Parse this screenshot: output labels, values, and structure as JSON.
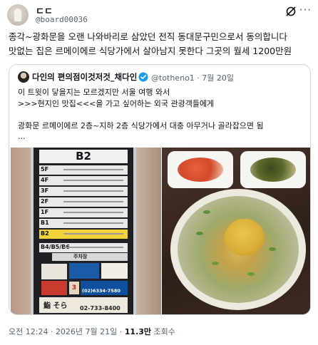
{
  "author": {
    "display_name": "ㄷㄷ",
    "handle": "@board00036"
  },
  "tweet": {
    "lines": [
      "종각~광화문을 오랜 나와바리로 삼았던 전직 동대문구민으로서 동의합니다",
      "맛없는 집은 르메이에르 식당가에서 살아남지 못한다 그곳의 월세 1200만원"
    ]
  },
  "quote": {
    "display_name": "다인의 편의점이것저것_채다인",
    "handle": "@totheno1",
    "date": "7월 20일",
    "separator": "·",
    "lines": [
      "이 트윗이 닿을지는 모르겠지만 서울 여행 와서",
      ">>>현지인 맛집<<<을 가고 싶어하는 외국 관광객들에게",
      "",
      "광화문 르메이에르 2층~지하 2층 식당가에서 대충 아무거나 골라잡으면 됨",
      "..."
    ]
  },
  "directory_sign": {
    "floor": "B2",
    "rows": [
      "5F",
      "4F",
      "3F",
      "2F",
      "1F",
      "B1",
      "B2",
      "B4/B5/B6"
    ],
    "parking_label": "주차장",
    "ad_phone": "02-733-8400",
    "ad_brand": "鮨 そら",
    "ad_phone_2": "(02)6334-7580",
    "ad_floor_tag": "3층"
  },
  "meta": {
    "time": "오전 12:24",
    "separator": "·",
    "date": "2026년 7월 21일",
    "views_count": "11.3만",
    "views_label": "조회수"
  },
  "colors": {
    "accent": "#1d9bf0",
    "muted": "#536471",
    "border": "#cfd9de"
  },
  "icons": [
    "grok-icon",
    "more-icon",
    "verified-badge-icon"
  ]
}
